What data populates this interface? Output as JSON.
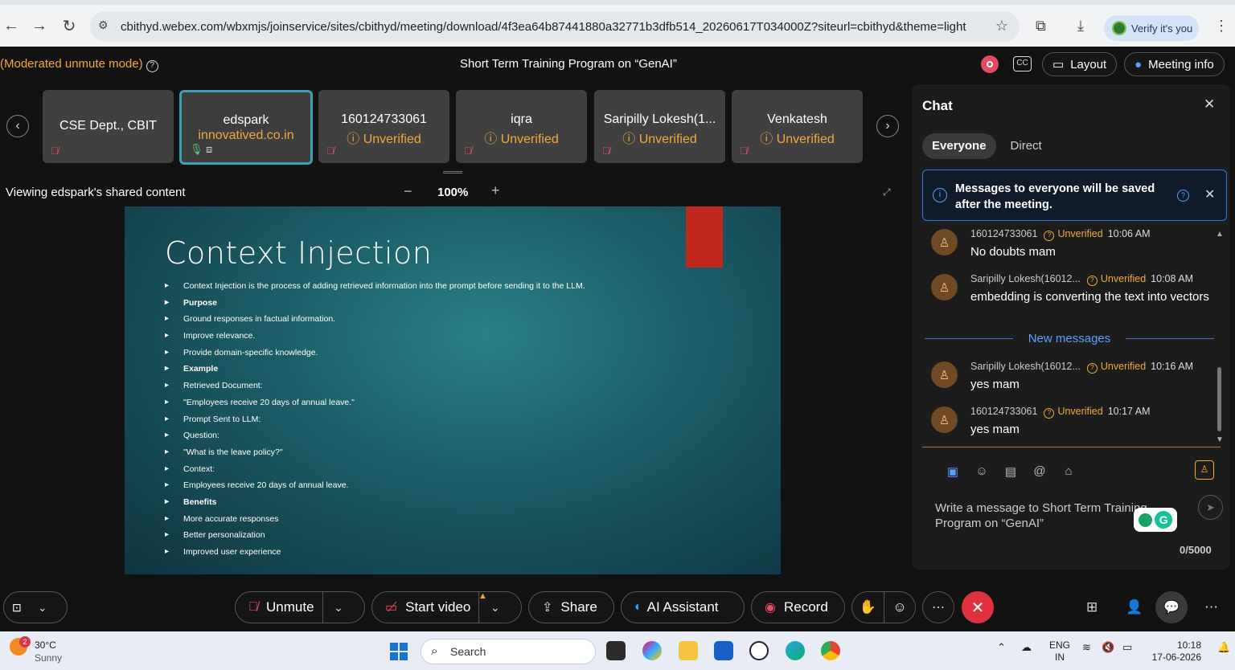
{
  "browser": {
    "url": "cbithyd.webex.com/wbxmjs/joinservice/sites/cbithyd/meeting/download/4f3ea64b87441880a32771b3dfb514_20260617T034000Z?siteurl=cbithyd&theme=light",
    "verify_label": "Verify it's you"
  },
  "meeting": {
    "mode": "(Moderated unmute mode)",
    "title": "Short Term Training Program on “GenAI”",
    "cc_label": "CC",
    "layout_label": "Layout",
    "meeting_info_label": "Meeting info"
  },
  "participants": [
    {
      "name": "CSE Dept., CBIT",
      "status": ""
    },
    {
      "name": "edspark",
      "status": "innovatived.co.in"
    },
    {
      "name": "160124733061",
      "status": "Unverified"
    },
    {
      "name": "iqra",
      "status": "Unverified"
    },
    {
      "name": "Saripilly Lokesh(1...",
      "status": "Unverified"
    },
    {
      "name": "Venkatesh",
      "status": "Unverified"
    }
  ],
  "share": {
    "viewing_label": "Viewing edspark's shared content",
    "zoom": "100%"
  },
  "slide": {
    "title": "Context Injection",
    "bullets": [
      {
        "text": "Context Injection is the process of adding retrieved information into the prompt before sending it to the LLM.",
        "bold": false
      },
      {
        "text": "Purpose",
        "bold": true
      },
      {
        "text": "Ground responses in factual information.",
        "bold": false
      },
      {
        "text": "Improve relevance.",
        "bold": false
      },
      {
        "text": "Provide domain-specific knowledge.",
        "bold": false
      },
      {
        "text": "Example",
        "bold": true
      },
      {
        "text": "Retrieved Document:",
        "bold": false
      },
      {
        "text": "\"Employees receive 20 days of annual leave.\"",
        "bold": false
      },
      {
        "text": "Prompt Sent to LLM:",
        "bold": false
      },
      {
        "text": "Question:",
        "bold": false
      },
      {
        "text": "\"What is the leave policy?\"",
        "bold": false
      },
      {
        "text": "Context:",
        "bold": false
      },
      {
        "text": "Employees receive 20 days of annual leave.",
        "bold": false
      },
      {
        "text": "Benefits",
        "bold": true
      },
      {
        "text": "More accurate responses",
        "bold": false
      },
      {
        "text": "Better personalization",
        "bold": false
      },
      {
        "text": "Improved user experience",
        "bold": false
      }
    ]
  },
  "chat": {
    "title": "Chat",
    "tab_everyone": "Everyone",
    "tab_direct": "Direct",
    "notice": "Messages to everyone will be saved after the meeting.",
    "new_messages_label": "New messages",
    "placeholder": "Write a message to Short Term Training Program on “GenAI”",
    "char_count": "0/5000",
    "messages": [
      {
        "sender": "160124733061",
        "status": "Unverified",
        "time": "10:06 AM",
        "text": "No doubts mam"
      },
      {
        "sender": "Saripilly Lokesh(16012...",
        "status": "Unverified",
        "time": "10:08 AM",
        "text": "embedding is converting the text into vectors"
      },
      {
        "sender": "Saripilly Lokesh(16012...",
        "status": "Unverified",
        "time": "10:16 AM",
        "text": "yes mam"
      },
      {
        "sender": "160124733061",
        "status": "Unverified",
        "time": "10:17 AM",
        "text": "yes mam"
      }
    ]
  },
  "controls": {
    "unmute": "Unmute",
    "start_video": "Start video",
    "share": "Share",
    "ai_assistant": "AI Assistant",
    "record": "Record"
  },
  "taskbar": {
    "weather_badge": "2",
    "temp": "30°C",
    "weather": "Sunny",
    "search": "Search",
    "lang_top": "ENG",
    "lang_bottom": "IN",
    "time": "10:18",
    "date": "17-06-2026"
  },
  "colors": {
    "accent_orange": "#f2a93b",
    "accent_blue": "#5aa0ff",
    "end_call_red": "#e0323c"
  }
}
